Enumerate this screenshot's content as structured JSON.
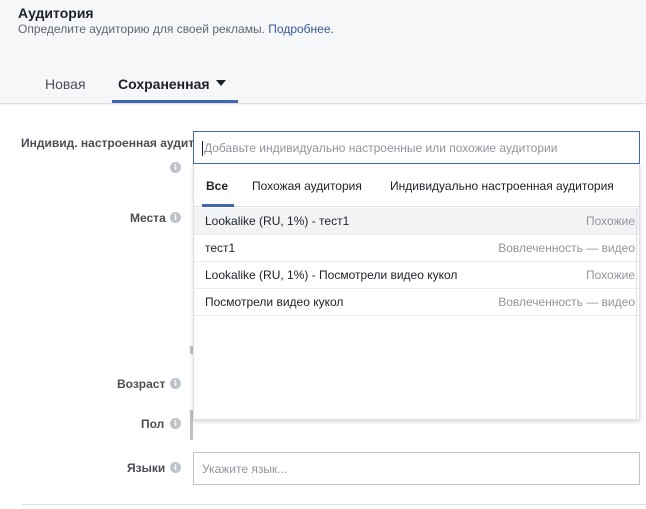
{
  "header": {
    "title": "Аудитория",
    "subtitle": "Определите аудиторию для своей рекламы.",
    "learn_more": "Подробнее."
  },
  "tabs": {
    "new_label": "Новая",
    "saved_label": "Сохраненная"
  },
  "fields": {
    "custom_audience_label": "Индивид. настроенная аудитория",
    "custom_audience_placeholder": "Добавьте индивидуально настроенные или похожие аудитории",
    "places_label": "Места",
    "age_label": "Возраст",
    "gender_label": "Пол",
    "languages_label": "Языки",
    "languages_placeholder": "Укажите язык..."
  },
  "dropdown": {
    "tabs": [
      "Все",
      "Похожая аудитория",
      "Индивидуально настроенная аудитория"
    ],
    "rows": [
      {
        "name": "Lookalike (RU, 1%) - тест1",
        "type": "Похожие"
      },
      {
        "name": "тест1",
        "type": "Вовлеченность — видео"
      },
      {
        "name": "Lookalike (RU, 1%) - Посмотрели видео кукол",
        "type": "Похожие"
      },
      {
        "name": "Посмотрели видео кукол",
        "type": "Вовлеченность — видео"
      }
    ]
  },
  "icons": {
    "info": "info-icon",
    "caret": "caret-down-icon"
  },
  "colors": {
    "accent": "#4267b2",
    "link": "#365899"
  }
}
